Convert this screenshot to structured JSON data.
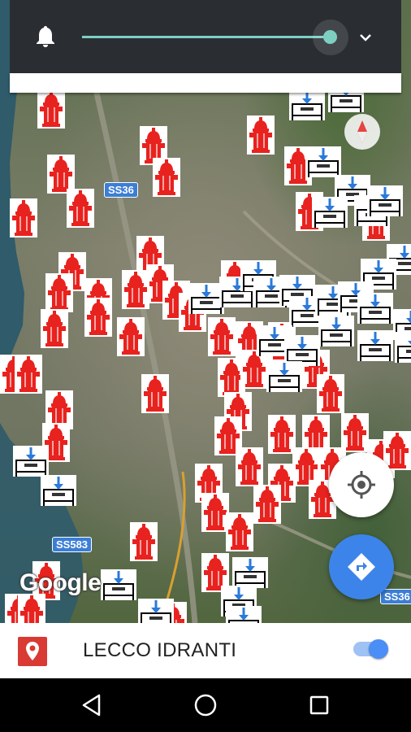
{
  "app": {
    "layer_name": "LECCO IDRANTI",
    "layer_enabled": true,
    "opacity_level": 0.97
  },
  "map": {
    "provider": "Google",
    "road_labels": [
      "SS36",
      "SS583",
      "SS36"
    ],
    "marker_types": [
      "hydrant-icon",
      "flow-sensor-icon"
    ]
  },
  "icons": {
    "notification": "bell-icon",
    "expand": "chevron-down-icon",
    "compass": "compass-icon",
    "locate": "my-location-icon",
    "directions": "directions-icon",
    "layer": "map-pin-icon",
    "back": "back-triangle-icon",
    "home": "home-circle-icon",
    "recents": "recents-square-icon"
  },
  "colors": {
    "hydrant_red": "#e8221e",
    "accent_teal": "#7dcfc2",
    "directions_blue": "#3d84ea",
    "road_label_blue": "#3b7ed6",
    "pin_red": "#d93a34",
    "toggle_blue": "#4b8ef5"
  }
}
